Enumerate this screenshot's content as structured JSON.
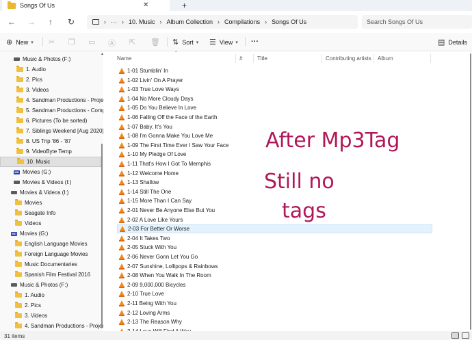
{
  "window": {
    "tab_title": "Songs Of Us",
    "tab_close": "✕",
    "tab_add": "+"
  },
  "address": {
    "back": "←",
    "forward": "→",
    "up": "↑",
    "refresh": "↻",
    "crumbs": [
      "10. Music",
      "Album Collection",
      "Compilations",
      "Songs Of Us"
    ],
    "overflow": "···",
    "sep": "›",
    "search_placeholder": "Search Songs Of Us"
  },
  "toolbar": {
    "new_label": "New",
    "sort_label": "Sort",
    "view_label": "View",
    "more_label": "···",
    "details_label": "Details"
  },
  "nav": [
    {
      "label": "Music & Photos (F:)",
      "type": "drive",
      "level": 1
    },
    {
      "label": "1. Audio",
      "type": "folder",
      "level": 2
    },
    {
      "label": "2. Pics",
      "type": "folder",
      "level": 2
    },
    {
      "label": "3. Videos",
      "type": "folder",
      "level": 2
    },
    {
      "label": "4. Sandman Productions - Project",
      "type": "folder",
      "level": 2
    },
    {
      "label": "5. Sandman Productions - Compl",
      "type": "folder",
      "level": 2
    },
    {
      "label": "6. Pictures (To be sorted)",
      "type": "folder",
      "level": 2
    },
    {
      "label": "7. Siblings Weekend [Aug 2020]",
      "type": "folder",
      "level": 2
    },
    {
      "label": "8. US Trip '86 - '87",
      "type": "folder",
      "level": 2
    },
    {
      "label": "9. VideoByte Temp",
      "type": "folder",
      "level": 2
    },
    {
      "label": "10. Music",
      "type": "folder",
      "level": 2,
      "selected": true
    },
    {
      "label": "Movies (G:)",
      "type": "wd",
      "level": 1
    },
    {
      "label": "Movies & Videos (I:)",
      "type": "drive",
      "level": 1
    },
    {
      "label": "Movies & Videos (I:)",
      "type": "drive",
      "level": 0
    },
    {
      "label": "Movies",
      "type": "folder",
      "level": 1
    },
    {
      "label": "Seagate Info",
      "type": "folder",
      "level": 1
    },
    {
      "label": "Videos",
      "type": "folder",
      "level": 1
    },
    {
      "label": "Movies (G:)",
      "type": "wd",
      "level": 0
    },
    {
      "label": "English Language Movies",
      "type": "folder",
      "level": 1
    },
    {
      "label": "Foreign Language Movies",
      "type": "folder",
      "level": 1
    },
    {
      "label": "Music Documentaries",
      "type": "folder",
      "level": 1
    },
    {
      "label": "Spanish Film Festival 2016",
      "type": "folder",
      "level": 1
    },
    {
      "label": "Music & Photos (F:)",
      "type": "drive",
      "level": 0
    },
    {
      "label": "1. Audio",
      "type": "folder",
      "level": 1
    },
    {
      "label": "2. Pics",
      "type": "folder",
      "level": 1
    },
    {
      "label": "3. Videos",
      "type": "folder",
      "level": 1
    },
    {
      "label": "4. Sandman Productions - Projects",
      "type": "folder",
      "level": 1
    }
  ],
  "columns": [
    "Name",
    "#",
    "Title",
    "Contributing artists",
    "Album"
  ],
  "files": [
    "1-01 Stumblin' In",
    "1-02 Livin' On A Prayer",
    "1-03 True Love Ways",
    "1-04 No More Cloudy Days",
    "1-05 Do You Believe In Love",
    "1-06 Falling Off the Face of the Earth",
    "1-07 Baby, It's You",
    "1-08 I'm Gonna Make You Love Me",
    "1-09 The First Time Ever I Saw Your Face",
    "1-10 My Pledge Of Love",
    "1-11 That's How I Got To Memphis",
    "1-12 Welcome Home",
    "1-13 Shallow",
    "1-14 Still The One",
    "1-15 More Than I Can Say",
    "2-01 Never Be Anyone Else But You",
    "2-02 A Love Like Yours",
    "2-03 For Better Or Worse",
    "2-04 It Takes Two",
    "2-05 Stuck With You",
    "2-06 Never Gonn Let You Go",
    "2-07 Sunshine, Lollipops & Rainbows",
    "2-08 When You Walk In The Room",
    "2-09 9,000,000 Bicycles",
    "2-10 True Love",
    "2-11 Being With You",
    "2-12 Loving Arms",
    "2-13 The Reason Why",
    "2-14 Love Will Find A Way"
  ],
  "hover_index": 17,
  "annotation": {
    "line1": "After Mp3Tag",
    "line2": "Still no",
    "line3": "tags",
    "color": "#b0185a"
  },
  "status": {
    "count": "31 items"
  }
}
